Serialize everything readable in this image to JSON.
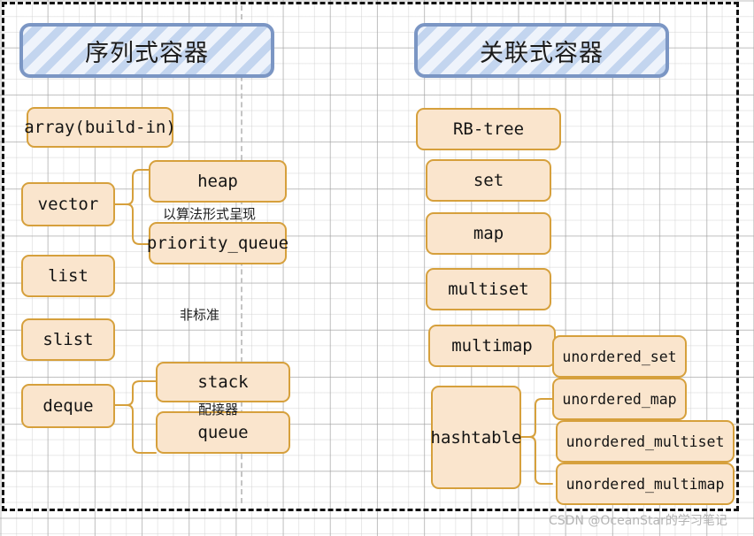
{
  "diagram": {
    "title_left": "序列式容器",
    "title_right": "关联式容器",
    "annotations": {
      "algorithm_form": "以算法形式呈现",
      "non_standard": "非标准",
      "adapter": "配接器"
    },
    "watermark": "CSDN @OceanStar的学习笔记",
    "colors": {
      "node_fill": "#fae5cd",
      "node_border": "#d6a03c",
      "plaque_border": "#7b96c4",
      "plaque_hatch": "#c3d5ef",
      "frame": "#111111"
    },
    "sequence_containers": [
      {
        "label": "array(build-in)"
      },
      {
        "label": "vector"
      },
      {
        "label": "heap"
      },
      {
        "label": "priority_queue"
      },
      {
        "label": "list"
      },
      {
        "label": "slist"
      },
      {
        "label": "deque"
      },
      {
        "label": "stack"
      },
      {
        "label": "queue"
      }
    ],
    "associative_containers": [
      {
        "label": "RB-tree"
      },
      {
        "label": "set"
      },
      {
        "label": "map"
      },
      {
        "label": "multiset"
      },
      {
        "label": "multimap"
      },
      {
        "label": "hashtable"
      },
      {
        "label": "unordered_set"
      },
      {
        "label": "unordered_map"
      },
      {
        "label": "unordered_multiset"
      },
      {
        "label": "unordered_multimap"
      }
    ]
  }
}
